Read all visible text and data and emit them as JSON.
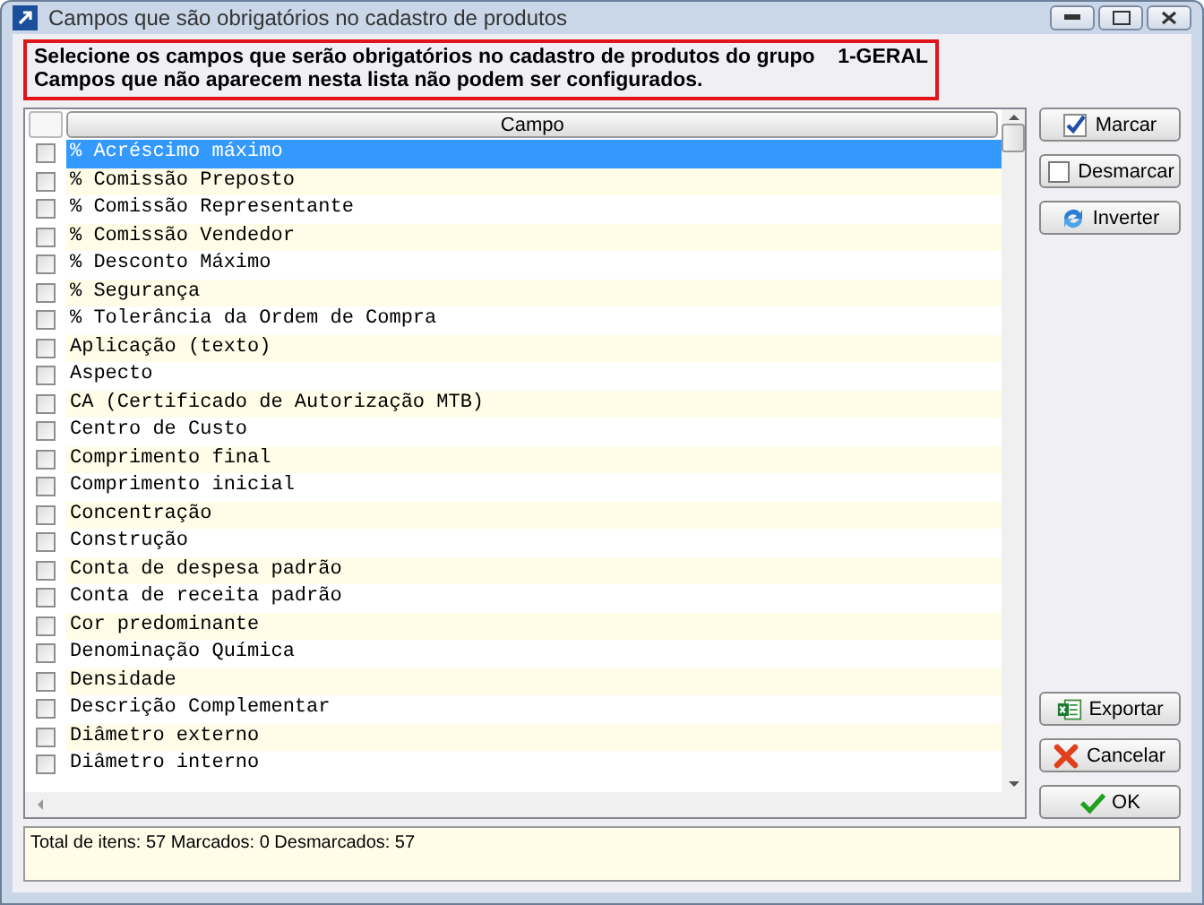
{
  "window": {
    "title": "Campos que são obrigatórios no cadastro de produtos"
  },
  "instructions": [
    "Selecione os campos que serão obrigatórios no cadastro de produtos do grupo    1-GERAL",
    "Campos que não aparecem nesta lista não podem ser configurados."
  ],
  "table": {
    "columns": [
      "Campo"
    ],
    "rows": [
      {
        "label": "% Acréscimo máximo",
        "checked": false,
        "selected": true
      },
      {
        "label": "% Comissão Preposto",
        "checked": false,
        "selected": false
      },
      {
        "label": "% Comissão Representante",
        "checked": false,
        "selected": false
      },
      {
        "label": "% Comissão Vendedor",
        "checked": false,
        "selected": false
      },
      {
        "label": "% Desconto Máximo",
        "checked": false,
        "selected": false
      },
      {
        "label": "% Segurança",
        "checked": false,
        "selected": false
      },
      {
        "label": "% Tolerância da Ordem de Compra",
        "checked": false,
        "selected": false
      },
      {
        "label": "Aplicação (texto)",
        "checked": false,
        "selected": false
      },
      {
        "label": "Aspecto",
        "checked": false,
        "selected": false
      },
      {
        "label": "CA (Certificado de Autorização MTB)",
        "checked": false,
        "selected": false
      },
      {
        "label": "Centro de Custo",
        "checked": false,
        "selected": false
      },
      {
        "label": "Comprimento final",
        "checked": false,
        "selected": false
      },
      {
        "label": "Comprimento inicial",
        "checked": false,
        "selected": false
      },
      {
        "label": "Concentração",
        "checked": false,
        "selected": false
      },
      {
        "label": "Construção",
        "checked": false,
        "selected": false
      },
      {
        "label": "Conta de despesa padrão",
        "checked": false,
        "selected": false
      },
      {
        "label": "Conta de receita padrão",
        "checked": false,
        "selected": false
      },
      {
        "label": "Cor predominante",
        "checked": false,
        "selected": false
      },
      {
        "label": "Denominação Química",
        "checked": false,
        "selected": false
      },
      {
        "label": "Densidade",
        "checked": false,
        "selected": false
      },
      {
        "label": "Descrição Complementar",
        "checked": false,
        "selected": false
      },
      {
        "label": "Diâmetro externo",
        "checked": false,
        "selected": false
      },
      {
        "label": "Diâmetro interno",
        "checked": false,
        "selected": false
      }
    ]
  },
  "side_buttons": [
    {
      "label": "Marcar",
      "kind": "check"
    },
    {
      "label": "Desmarcar",
      "kind": "uncheck"
    },
    {
      "label": "Inverter",
      "kind": "invert"
    }
  ],
  "bottom_buttons": [
    {
      "label": "Exportar",
      "kind": "excel"
    },
    {
      "label": "Cancelar",
      "kind": "cancel"
    },
    {
      "label": "OK",
      "kind": "ok"
    }
  ],
  "status_bar": "Total de itens: 57 Marcados: 0 Desmarcados: 57"
}
